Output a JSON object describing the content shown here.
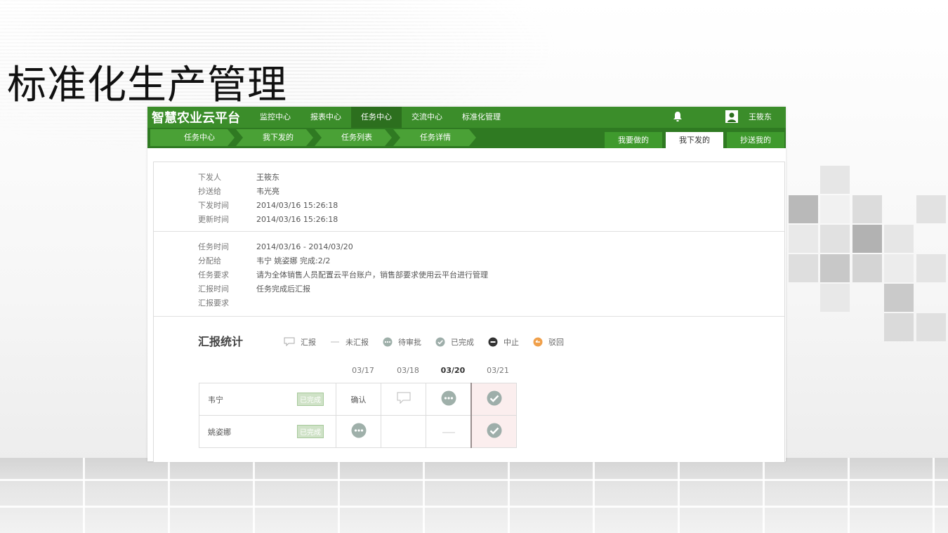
{
  "slide": {
    "title": "标准化生产管理"
  },
  "app": {
    "logo": "智慧农业云平台",
    "nav": [
      "监控中心",
      "报表中心",
      "任务中心",
      "交流中心",
      "标准化管理"
    ],
    "active_nav": "任务中心",
    "user": "王筱东",
    "breadcrumbs": [
      "任务中心",
      "我下发的",
      "任务列表",
      "任务详情"
    ],
    "right_tabs": [
      "我要做的",
      "我下发的",
      "抄送我的"
    ],
    "active_right_tab": "我下发的"
  },
  "detail": {
    "section1": [
      {
        "label": "下发人",
        "value": "王筱东"
      },
      {
        "label": "抄送给",
        "value": "韦光亮"
      },
      {
        "label": "下发时间",
        "value": "2014/03/16 15:26:18"
      },
      {
        "label": "更新时间",
        "value": "2014/03/16 15:26:18"
      }
    ],
    "section2": [
      {
        "label": "任务时间",
        "value": "2014/03/16 - 2014/03/20"
      },
      {
        "label": "分配给",
        "value": "韦宁  姚姿娜  完成:2/2"
      },
      {
        "label": "任务要求",
        "value": "请为全体销售人员配置云平台账户，销售部要求使用云平台进行管理"
      },
      {
        "label": "汇报时间",
        "value": "任务完成后汇报"
      },
      {
        "label": "汇报要求",
        "value": ""
      }
    ]
  },
  "stats": {
    "title": "汇报统计",
    "legend": [
      {
        "label": "汇报",
        "icon": "comment-icon"
      },
      {
        "label": "未汇报",
        "icon": "dash-icon"
      },
      {
        "label": "待审批",
        "icon": "pending-icon"
      },
      {
        "label": "已完成",
        "icon": "check-icon"
      },
      {
        "label": "中止",
        "icon": "stop-icon"
      },
      {
        "label": "驳回",
        "icon": "reject-icon"
      }
    ],
    "dates": [
      "03/17",
      "03/18",
      "03/20",
      "03/21"
    ],
    "rows": [
      {
        "name": "韦宁",
        "status": "已完成",
        "cells": [
          "确认",
          "comment-icon",
          "pending-icon",
          "check-icon"
        ]
      },
      {
        "name": "姚姿娜",
        "status": "已完成",
        "cells": [
          "pending-icon",
          "",
          "dash-icon",
          "check-icon"
        ]
      }
    ]
  },
  "colors": {
    "brand_green": "#3b8d2a",
    "dark_green": "#2c6f1e",
    "reject_orange": "#f0a04b"
  }
}
